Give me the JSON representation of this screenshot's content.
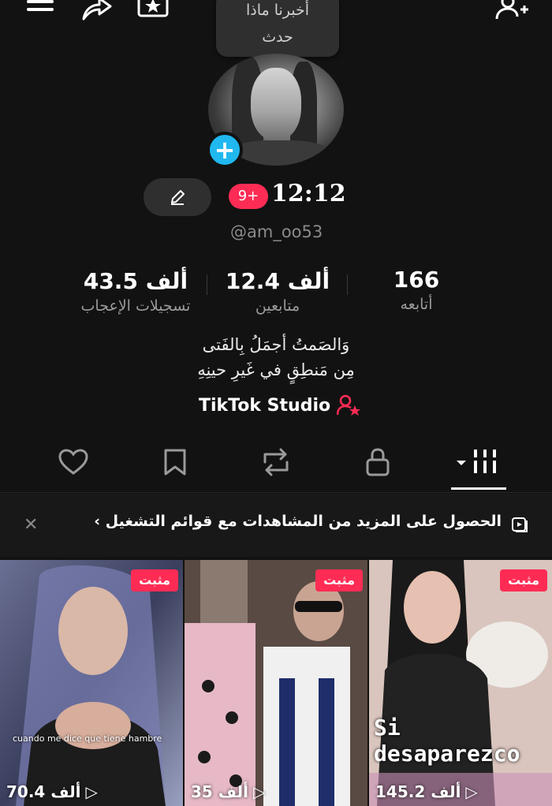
{
  "top_bar": {
    "icons": [
      "menu-icon",
      "share-icon",
      "star-box-icon",
      "add-user-icon"
    ]
  },
  "tooltip": {
    "line1": "أخبرنا ماذا",
    "line2": "حدث"
  },
  "profile": {
    "badge": "9+",
    "name": "12:12",
    "username": "@am_oo53"
  },
  "stats": [
    {
      "value": "43.5 ألف",
      "label": "تسجيلات الإعجاب"
    },
    {
      "value": "12.4 ألف",
      "label": "متابعين"
    },
    {
      "value": "166",
      "label": "أتابعه"
    }
  ],
  "bio": {
    "line1": "وَالصَمتُ أجمَلُ بِالفَتى",
    "line2": "مِن مَنطِقٍ في غَيرِ حينِهِ"
  },
  "studio_link": "TikTok Studio",
  "tabs": [
    "heart-icon",
    "bookmark-icon",
    "repost-icon",
    "lock-icon",
    "grid-icon"
  ],
  "promo": {
    "text": "الحصول على المزيد من المشاهدات مع قوائم التشغيل ›"
  },
  "videos": [
    {
      "pinned": "مثبت",
      "views": "70.4 ألف",
      "caption": "cuando me dice que tiene hambre"
    },
    {
      "pinned": "مثبت",
      "views": "35 ألف",
      "caption": ""
    },
    {
      "pinned": "مثبت",
      "views": "145.2 ألف",
      "caption": "Si desaparezco"
    }
  ],
  "colors": {
    "accent": "#fe2c55",
    "add_button": "#20b8ef",
    "background": "#121212"
  }
}
